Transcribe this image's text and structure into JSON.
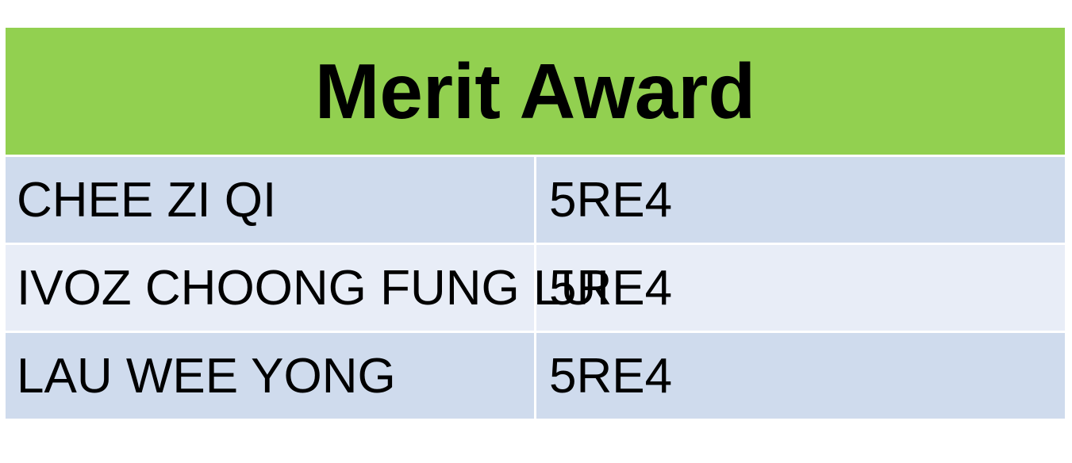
{
  "title": "Merit Award",
  "rows": [
    {
      "name": "CHEE ZI QI",
      "class": "5RE4"
    },
    {
      "name": "IVOZ CHOONG FUNG LUI",
      "class": "5RE4"
    },
    {
      "name": "LAU WEE YONG",
      "class": "5RE4"
    }
  ],
  "colors": {
    "header_bg": "#92d050",
    "row_dark": "#cfdbed",
    "row_light": "#e8edf7"
  }
}
